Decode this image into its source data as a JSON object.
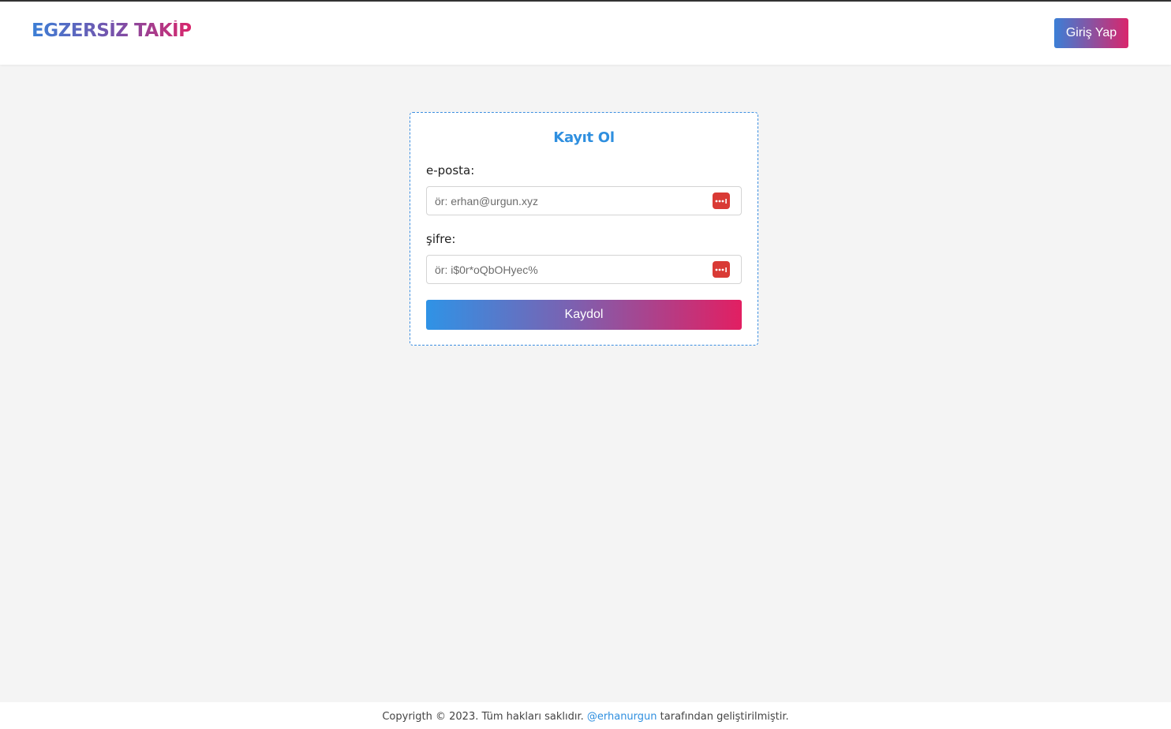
{
  "header": {
    "logo": "EGZERSİZ TAKİP",
    "login_button": "Giriş Yap"
  },
  "form": {
    "title": "Kayıt Ol",
    "email": {
      "label": "e-posta:",
      "placeholder": "ör: erhan@urgun.xyz",
      "value": ""
    },
    "password": {
      "label": "şifre:",
      "placeholder": "ör: i$0r*oQbOHyec%",
      "value": ""
    },
    "submit_label": "Kaydol",
    "field_icon": "password-manager-icon"
  },
  "footer": {
    "prefix": "Copyrigth © 2023. Tüm hakları saklıdır.",
    "author_link": "@erhanurgun",
    "suffix": "tarafından geliştirilmiştir."
  },
  "colors": {
    "accent_blue": "#2f8fdf",
    "accent_pink": "#e21f62",
    "page_background": "#f4f4f4",
    "password_icon": "#d93a35"
  }
}
